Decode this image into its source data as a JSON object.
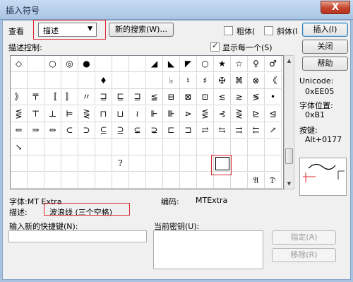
{
  "window": {
    "title": "插入符号",
    "close_glyph": "X"
  },
  "view": {
    "label": "查看",
    "selected": "描述",
    "new_search_button": "新的搜索(W)...",
    "bold_label": "粗体(",
    "italic_label": "斜体(I",
    "insert_button": "插入(I)",
    "close_button": "关闭",
    "help_button": "帮助"
  },
  "description_control_label": "描述控制:",
  "show_every_label": "显示每一个(S)",
  "show_every_checked": true,
  "symbol_grid": {
    "rows": [
      [
        "◇",
        "",
        "○",
        "◎",
        "●",
        "",
        "",
        "",
        "◢",
        "◣",
        "◤",
        "○",
        "★",
        "☆",
        "♀",
        "♂"
      ],
      [
        "",
        "",
        "",
        "",
        "",
        "♦",
        "",
        "",
        "",
        "♭",
        "♮",
        "♯",
        "✠",
        "⌘",
        "⊗",
        "《"
      ],
      [
        "》",
        "〒",
        "〚",
        "〛",
        "〃",
        "⊒",
        "⊑",
        "⊒",
        "≦",
        "⊟",
        "⊠",
        "⊡",
        "≲",
        "≳",
        "≶",
        "•"
      ],
      [
        "⋚",
        "⊤",
        "⊥",
        "⊨",
        "⋛",
        "⊓",
        "⊔",
        "≀",
        "⊩",
        "⊪",
        "⋗",
        "⋚",
        "⊰",
        "⋛",
        "⊵",
        "⊴"
      ],
      [
        "⇐",
        "⇒",
        "⇔",
        "⊂",
        "⊃",
        "⊆",
        "⊇",
        "⊊",
        "⊋",
        "⊏",
        "⊐",
        "⇄",
        "⇆",
        "⇉",
        "⇇",
        "↗"
      ],
      [
        "↘",
        "",
        "",
        "",
        "",
        "",
        "",
        "",
        "",
        "",
        "",
        "",
        "",
        "",
        "",
        ""
      ],
      [
        "",
        "",
        "",
        "",
        "",
        "",
        "?",
        "",
        "",
        "",
        "",
        "",
        "",
        "",
        "",
        ""
      ],
      [
        "",
        "",
        "",
        "",
        "",
        "",
        "",
        "",
        "",
        "",
        "",
        "",
        "",
        "",
        "𝔄",
        "𝔇"
      ]
    ],
    "selected_row": 6,
    "selected_col": 12
  },
  "info": {
    "unicode_label": "Unicode:",
    "unicode_value": "0xEE05",
    "font_pos_label": "字体位置:",
    "font_pos_value": "0xB1",
    "keystroke_label": "按键:",
    "keystroke_value": "Alt+0177"
  },
  "font_label": "字体:MT Extra",
  "code_label": "编码:",
  "code_value": "MTExtra",
  "description_label": "描述:",
  "description_value": "波浪线 (三个空格)",
  "shortcut": {
    "new_label": "输入新的快捷键(N):",
    "new_value": "",
    "current_label": "当前密钥(U):"
  },
  "assign_button": "指定(A)",
  "remove_button": "移除(R)",
  "colors": {
    "highlight_red": "#d8262c",
    "title_blue": "#a9c4e4"
  }
}
